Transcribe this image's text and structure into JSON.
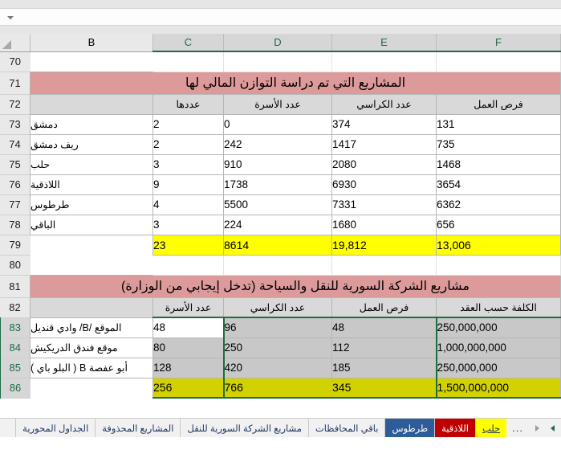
{
  "formula_bar": {
    "value": "",
    "placeholder": "",
    "expand_icon": "chevron-down-icon"
  },
  "grid": {
    "columns": [
      {
        "letter": "F",
        "selected": true
      },
      {
        "letter": "E",
        "selected": true
      },
      {
        "letter": "D",
        "selected": true
      },
      {
        "letter": "C",
        "selected": true
      },
      {
        "letter": "B",
        "selected": false
      }
    ],
    "row_numbers": [
      "70",
      "71",
      "72",
      "73",
      "74",
      "75",
      "76",
      "77",
      "78",
      "79",
      "80",
      "81",
      "82",
      "83",
      "84",
      "85",
      "86"
    ],
    "selected_rows": [
      "83",
      "84",
      "85",
      "86"
    ]
  },
  "table1": {
    "title": "المشاريع التي تم دراسة التوازن المالي لها",
    "headers": {
      "F": "فرص العمل",
      "E": "عدد الكراسي",
      "D": "عدد الأسرة",
      "C": "عددها",
      "B": ""
    },
    "rows": [
      {
        "row": "73",
        "B": "دمشق",
        "C": "2",
        "D": "0",
        "E": "374",
        "F": "131"
      },
      {
        "row": "74",
        "B": "ريف دمشق",
        "C": "2",
        "D": "242",
        "E": "1417",
        "F": "735"
      },
      {
        "row": "75",
        "B": "حلب",
        "C": "3",
        "D": "910",
        "E": "2080",
        "F": "1468"
      },
      {
        "row": "76",
        "B": "اللاذقية",
        "C": "9",
        "D": "1738",
        "E": "6930",
        "F": "3654"
      },
      {
        "row": "77",
        "B": "طرطوس",
        "C": "4",
        "D": "5500",
        "E": "7331",
        "F": "6362"
      },
      {
        "row": "78",
        "B": "الباقي",
        "C": "3",
        "D": "224",
        "E": "1680",
        "F": "656"
      }
    ],
    "total": {
      "row": "79",
      "B": "",
      "C": "23",
      "D": "8614",
      "E": "19,812",
      "F": "13,006"
    }
  },
  "table2": {
    "title": "مشاريع الشركة السورية للنقل والسياحة (تدخل إيجابي من الوزارة)",
    "headers": {
      "F": "الكلفة حسب العقد",
      "E": "فرص العمل",
      "D": "عدد الكراسي",
      "C": "عدد الأسرة",
      "B": ""
    },
    "rows": [
      {
        "row": "83",
        "B": "الموقع /B/ وادي قنديل",
        "C": "48",
        "D": "96",
        "E": "48",
        "F": "250,000,000"
      },
      {
        "row": "84",
        "B": "موقع فندق الدريكيش",
        "C": "80",
        "D": "250",
        "E": "112",
        "F": "1,000,000,000"
      },
      {
        "row": "85",
        "B": "أبو عفصة B ( البلو باي )",
        "C": "128",
        "D": "420",
        "E": "185",
        "F": "250,000,000"
      }
    ],
    "total": {
      "row": "86",
      "B": "",
      "C": "256",
      "D": "766",
      "E": "345",
      "F": "1,500,000,000"
    }
  },
  "tabs": {
    "nav_next_icon": "triangle-right-icon",
    "nav_prev_icon": "triangle-left-icon",
    "overflow_label": "...",
    "items": [
      {
        "label": "حلب",
        "color": "#ffff00",
        "style": "c-yellow"
      },
      {
        "label": "اللاذقية",
        "color": "#c00000",
        "style": "c-red"
      },
      {
        "label": "طرطوس",
        "color": "#2e5c99",
        "style": "c-blue"
      },
      {
        "label": "باقي المحافظات",
        "color": "#f1f1f1",
        "style": ""
      },
      {
        "label": "مشاريع الشركة السورية للنقل",
        "color": "#f1f1f1",
        "style": ""
      },
      {
        "label": "المشاريع المحذوفة",
        "color": "#f1f1f1",
        "style": ""
      },
      {
        "label": "الجداول المحورية",
        "color": "#f1f1f1",
        "style": ""
      }
    ]
  },
  "colors": {
    "title_band": "#dd9a9a",
    "header_band": "#d9d9d9",
    "total_yellow": "#ffff00",
    "total_olive": "#d2d200",
    "selection_green": "#1e6b44",
    "selection_shade": "#c8c8c8"
  }
}
